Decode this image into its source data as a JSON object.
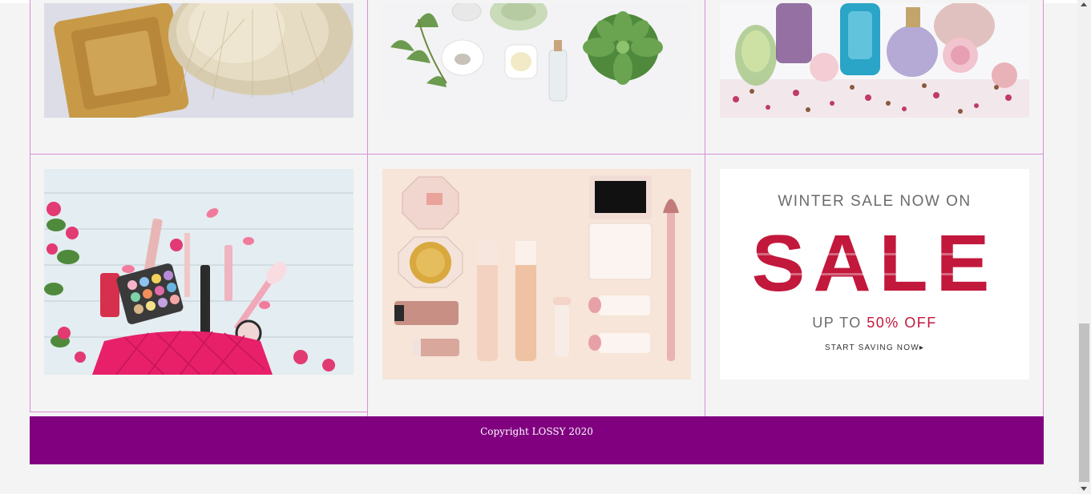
{
  "gallery": {
    "images": [
      {
        "icon": "soap-and-brush-photo"
      },
      {
        "icon": "skincare-flatlay-photo"
      },
      {
        "icon": "perfume-bottles-photo"
      },
      {
        "icon": "makeup-bag-photo"
      },
      {
        "icon": "fenty-beauty-products-photo"
      },
      {
        "icon": "winter-sale-banner"
      }
    ]
  },
  "sale_banner": {
    "headline": "WINTER SALE NOW ON",
    "word": "SALE",
    "offer_prefix": "UP TO ",
    "offer_value": "50% OFF",
    "cta": "START SAVING NOW▸"
  },
  "footer": {
    "copyright": "Copyright LOSSY 2020"
  },
  "colors": {
    "background": "#f4f4f4",
    "footer": "#800080",
    "cell_border": "#d68fd6",
    "sale_accent": "#c2183c"
  }
}
